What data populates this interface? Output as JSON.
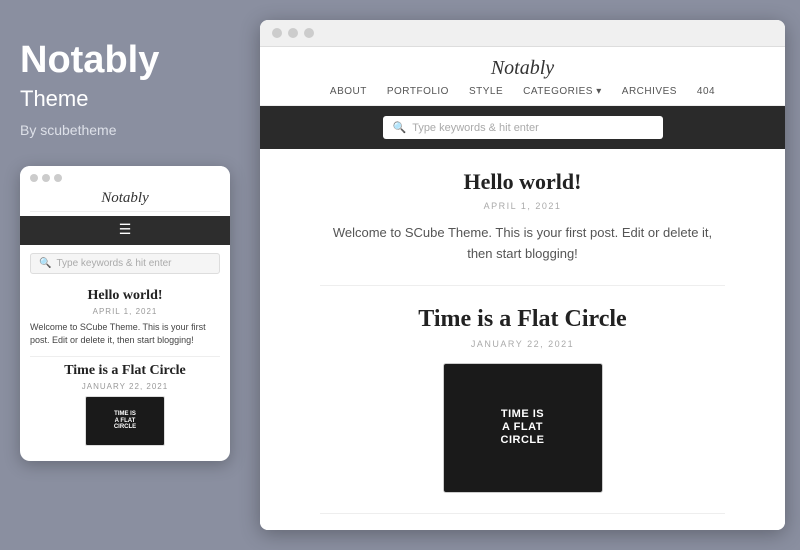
{
  "left": {
    "title": "Notably",
    "subtitle": "Theme",
    "author": "By scubetheme"
  },
  "mobile": {
    "site_title": "Notably",
    "search_placeholder": "Type keywords & hit enter",
    "post1": {
      "title": "Hello world!",
      "date": "APRIL 1, 2021",
      "excerpt": "Welcome to SCube Theme. This is your first post. Edit or delete it, then start blogging!"
    },
    "post2": {
      "title": "Time is a Flat Circle",
      "date": "JANUARY 22, 2021"
    }
  },
  "desktop": {
    "site_title": "Notably",
    "nav": [
      "ABOUT",
      "PORTFOLIO",
      "STYLE",
      "CATEGORIES ▾",
      "ARCHIVES",
      "404"
    ],
    "search_placeholder": "Type keywords & hit enter",
    "post1": {
      "title": "Hello world!",
      "date": "APRIL 1, 2021",
      "excerpt": "Welcome to SCube Theme. This is your first post. Edit or delete it, then start blogging!"
    },
    "post2": {
      "title": "Time is a Flat Circle",
      "date": "JANUARY 22, 2021"
    },
    "thumb_text": "TIME IS A FLAT CIRCLE"
  },
  "dots": {
    "label": "•••"
  }
}
